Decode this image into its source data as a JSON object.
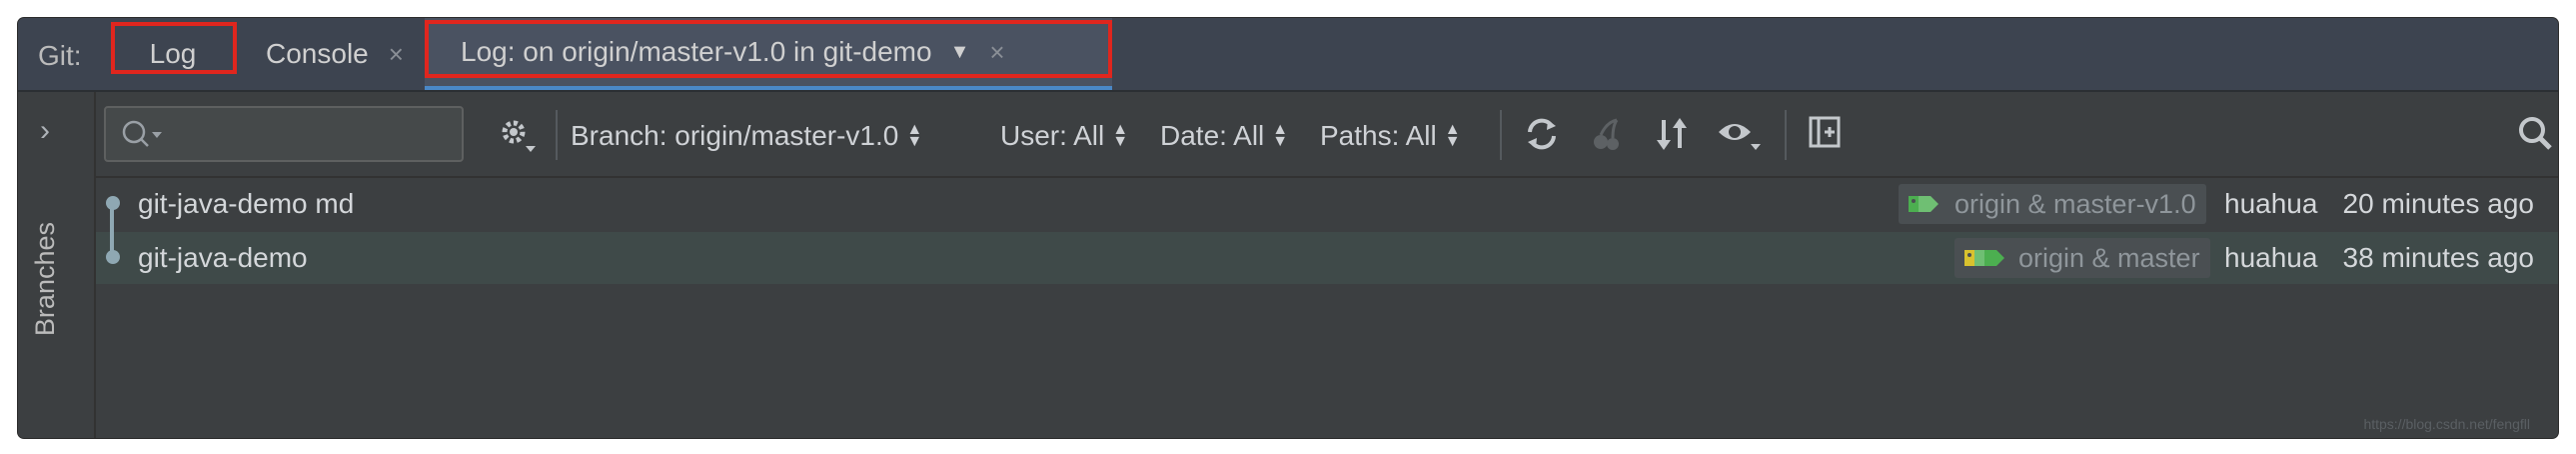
{
  "tabbar": {
    "prefix": "Git:",
    "tabs": [
      {
        "label": "Log"
      },
      {
        "label": "Console",
        "close": "×"
      },
      {
        "label": "Log: on origin/master-v1.0 in git-demo",
        "dropdown": "▼",
        "close": "×"
      }
    ]
  },
  "rail": {
    "expand_icon": "chevron-right-icon",
    "expand_glyph": "›",
    "branches_label": "Branches"
  },
  "toolbar": {
    "search": {
      "value": "",
      "placeholder": ""
    },
    "filters": [
      {
        "label": "Branch: origin/master-v1.0"
      },
      {
        "label": "User: All"
      },
      {
        "label": "Date: All"
      },
      {
        "label": "Paths: All"
      }
    ],
    "icons": [
      "gear-icon",
      "refresh-icon",
      "cherry-pick-icon",
      "sort-icon",
      "eye-icon",
      "new-tab-icon",
      "search-icon"
    ]
  },
  "commits": [
    {
      "message": "git-java-demo md",
      "refs": "origin & master-v1.0",
      "tag_colors": [
        "#4caf50",
        "#6fbf73"
      ],
      "author": "huahua",
      "date": "20 minutes ago"
    },
    {
      "message": "git-java-demo",
      "refs": "origin & master",
      "tag_colors": [
        "#d9c22e",
        "#6fbf73"
      ],
      "author": "huahua",
      "date": "38 minutes ago"
    }
  ],
  "colors": {
    "highlight": "#e0261e",
    "active_tab_underline": "#4a88c7"
  },
  "watermark": "https://blog.csdn.net/fengfll"
}
